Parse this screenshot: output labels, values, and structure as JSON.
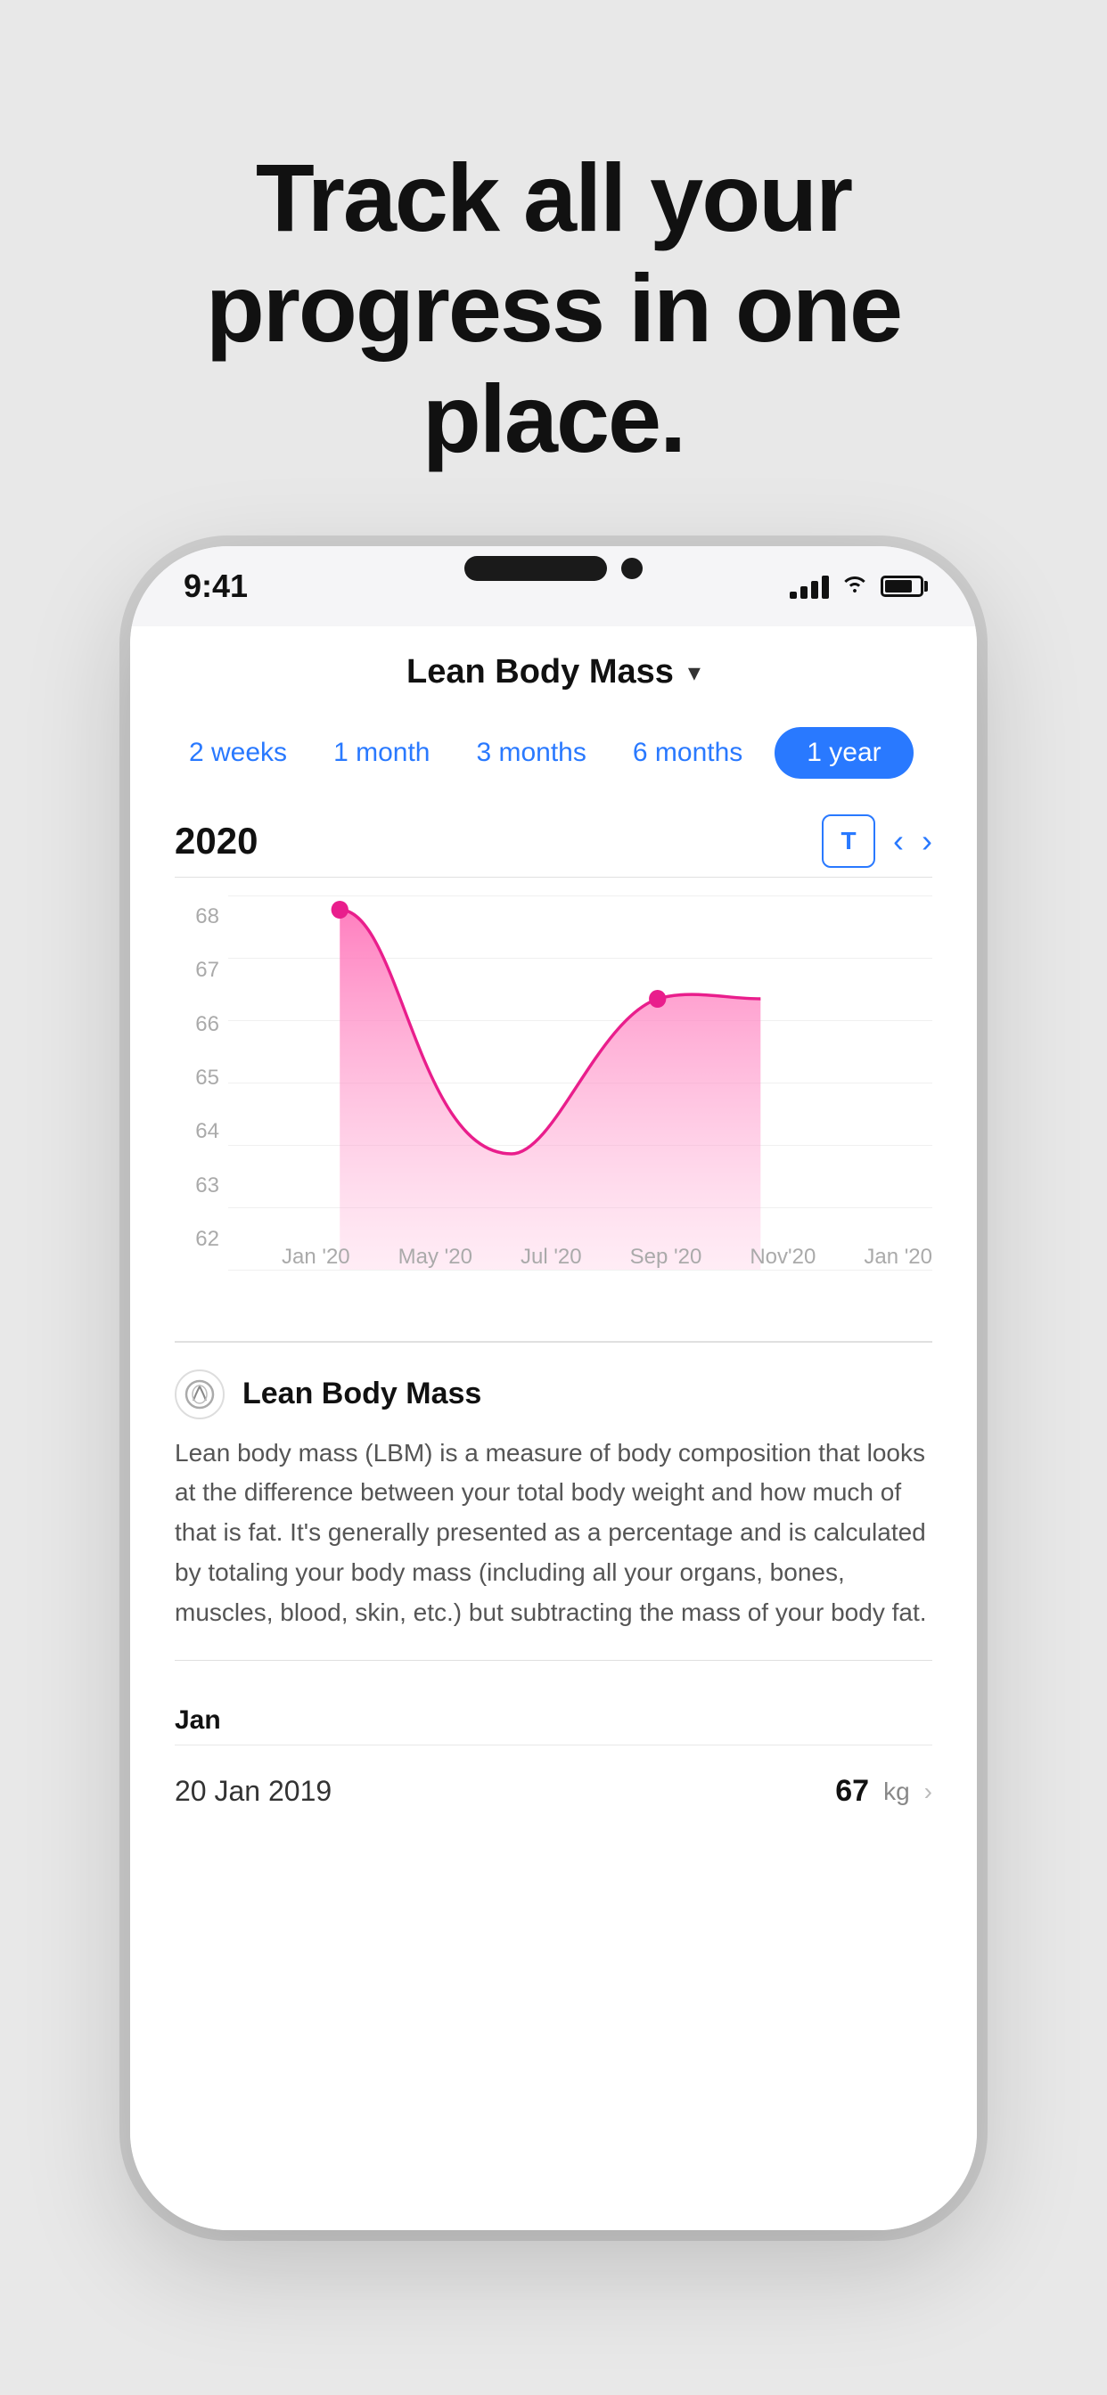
{
  "hero": {
    "title": "Track all your progress in one place."
  },
  "status_bar": {
    "time": "9:41",
    "signal": "●●●",
    "wifi": "wifi",
    "battery": "battery"
  },
  "header": {
    "title": "Lean Body Mass",
    "chevron": "▾"
  },
  "period_tabs": [
    {
      "label": "2 weeks",
      "active": false
    },
    {
      "label": "1 month",
      "active": false
    },
    {
      "label": "3 months",
      "active": false
    },
    {
      "label": "6 months",
      "active": false
    },
    {
      "label": "1 year",
      "active": true
    }
  ],
  "year_row": {
    "label": "2020",
    "t_button": "T",
    "prev": "‹",
    "next": "›"
  },
  "chart": {
    "y_labels": [
      "68",
      "67",
      "66",
      "65",
      "64",
      "63",
      "62"
    ],
    "x_labels": [
      "Jan '20",
      "May '20",
      "Jul '20",
      "Sep '20",
      "Nov'20",
      "Jan '20"
    ]
  },
  "info_section": {
    "icon": "⊙",
    "title": "Lean Body Mass",
    "description": "Lean body mass (LBM) is a measure of body composition that looks at the difference between your total body weight and how much of that is fat. It's generally presented as a percentage and is calculated by totaling your body mass (including all your organs, bones, muscles, blood, skin, etc.) but subtracting the mass of your body fat."
  },
  "data_section": {
    "month_label": "Jan",
    "rows": [
      {
        "date": "20 Jan 2019",
        "value": "67",
        "unit": "kg"
      }
    ]
  }
}
